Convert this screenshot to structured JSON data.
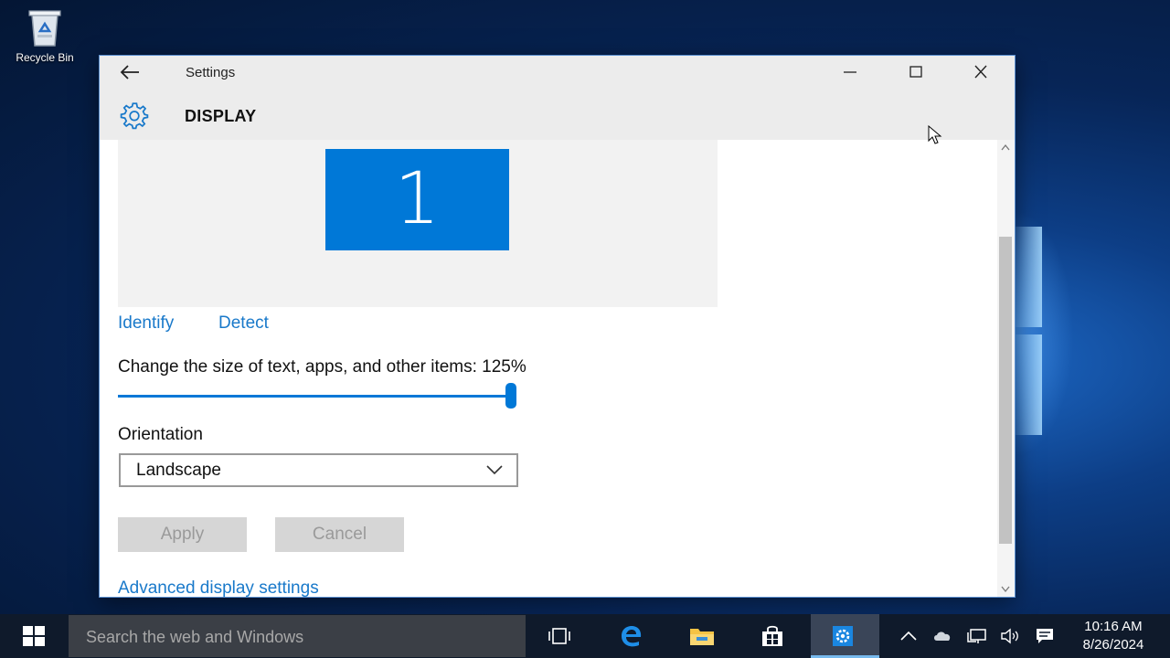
{
  "desktop": {
    "recycle_bin_label": "Recycle Bin"
  },
  "window": {
    "title": "Settings",
    "page_title": "DISPLAY",
    "icons": {
      "back": "back-arrow-icon",
      "minimize": "minimize-icon",
      "maximize": "maximize-icon",
      "close": "close-icon",
      "page": "gear-icon"
    }
  },
  "display": {
    "monitor_number": "1",
    "identify_label": "Identify",
    "detect_label": "Detect",
    "scale_label": "Change the size of text, apps, and other items: 125%",
    "scale_slider_value_fraction": 1.0,
    "orientation_label": "Orientation",
    "orientation_value": "Landscape",
    "apply_label": "Apply",
    "cancel_label": "Cancel",
    "advanced_label": "Advanced display settings"
  },
  "taskbar": {
    "search_placeholder": "Search the web and Windows",
    "apps": [
      "task-view-icon",
      "edge-icon",
      "file-explorer-icon",
      "store-icon",
      "settings-icon"
    ],
    "tray_icons": [
      "chevron-up-icon",
      "cloud-icon",
      "network-icon",
      "volume-icon",
      "action-center-icon"
    ],
    "time": "10:16 AM",
    "date": "8/26/2024"
  },
  "colors": {
    "accent": "#0078d7",
    "link": "#1979ca",
    "taskbar": "#0f1a2b"
  }
}
